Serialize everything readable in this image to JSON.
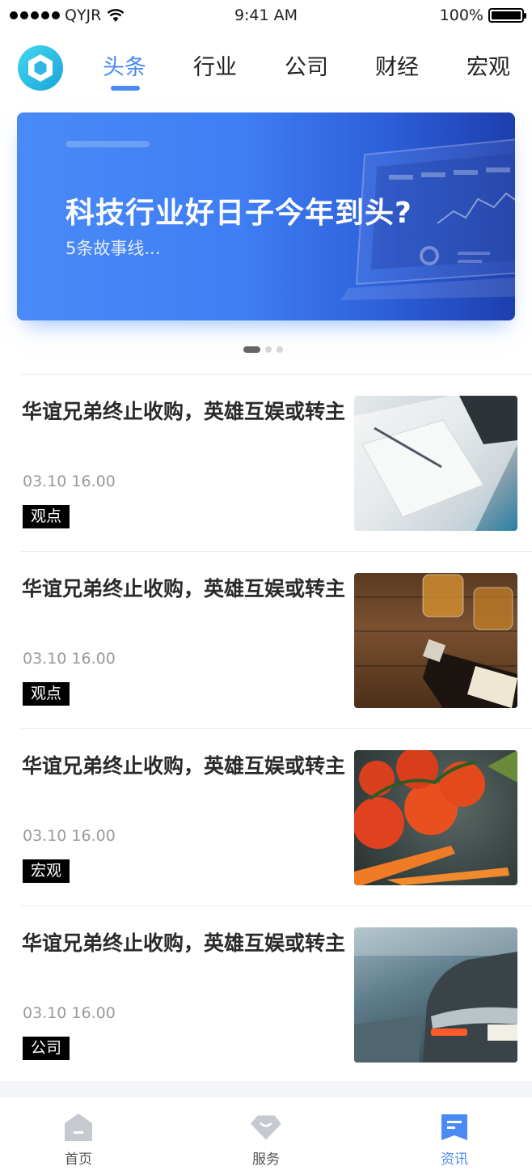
{
  "status_bar": {
    "carrier": "QYJR",
    "time": "9:41 AM",
    "battery": "100%"
  },
  "top_nav": {
    "tabs": [
      {
        "label": "头条",
        "active": true
      },
      {
        "label": "行业",
        "active": false
      },
      {
        "label": "公司",
        "active": false
      },
      {
        "label": "财经",
        "active": false
      },
      {
        "label": "宏观",
        "active": false
      }
    ]
  },
  "banner": {
    "title": "科技行业好日子今年到头?",
    "subtitle": "5条故事线...",
    "page_count": 3,
    "current_page": 1
  },
  "feed": {
    "items": [
      {
        "title": "华谊兄弟终止收购，英雄互娱或转主",
        "time": "03.10 16.00",
        "tag": "观点",
        "image": "notebook-pen-photo"
      },
      {
        "title": "华谊兄弟终止收购，英雄互娱或转主",
        "time": "03.10 16.00",
        "tag": "观点",
        "image": "whisky-glasses-photo"
      },
      {
        "title": "华谊兄弟终止收购，英雄互娱或转主",
        "time": "03.10 16.00",
        "tag": "宏观",
        "image": "tomatoes-carrots-photo"
      },
      {
        "title": "华谊兄弟终止收购，英雄互娱或转主",
        "time": "03.10 16.00",
        "tag": "公司",
        "image": "porsche-car-photo"
      }
    ]
  },
  "tab_bar": {
    "items": [
      {
        "label": "首页",
        "icon": "home-icon",
        "active": false
      },
      {
        "label": "服务",
        "icon": "diamond-icon",
        "active": false
      },
      {
        "label": "资讯",
        "icon": "news-icon",
        "active": true
      }
    ]
  },
  "colors": {
    "accent": "#4a8af4",
    "tag_bg": "#000000",
    "meta_text": "#9a9a9a"
  }
}
